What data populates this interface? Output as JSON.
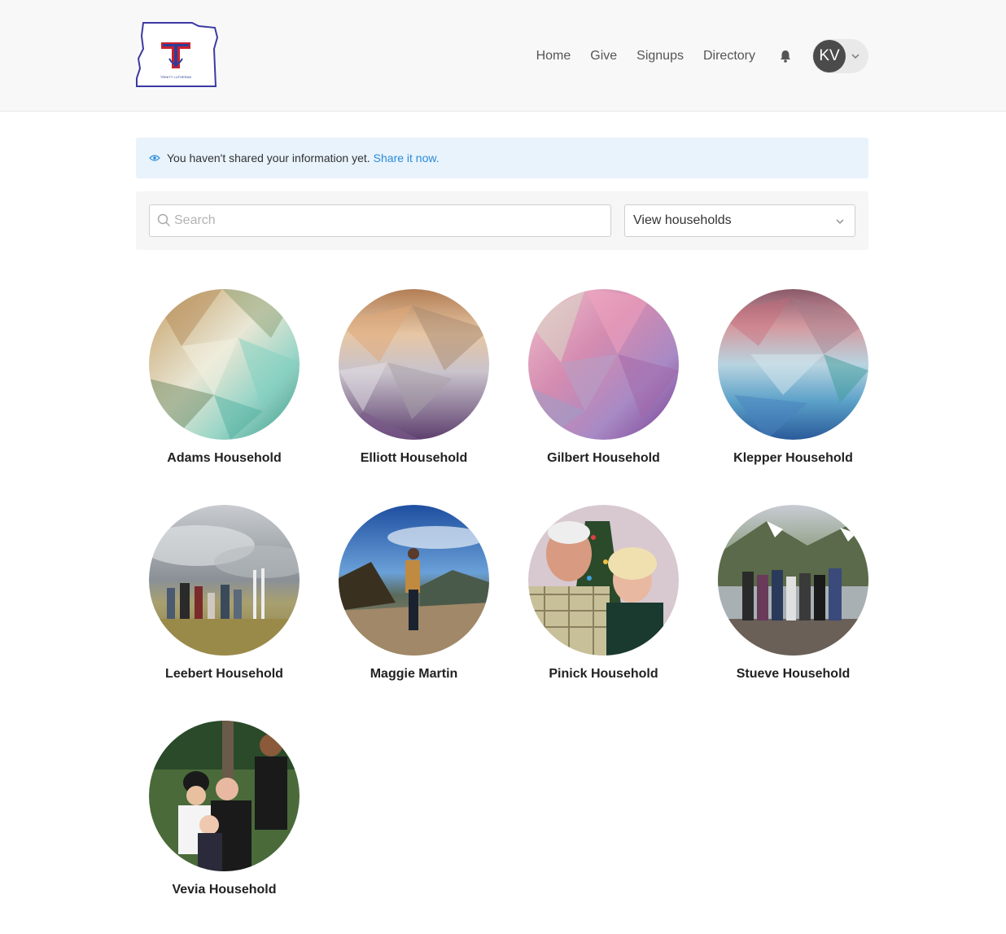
{
  "header": {
    "logo_text": "TRINITY LUTHERAN",
    "nav": [
      "Home",
      "Give",
      "Signups",
      "Directory"
    ],
    "user_initials": "KV"
  },
  "notice": {
    "text": "You haven't shared your information yet.",
    "link": "Share it now."
  },
  "filters": {
    "search_placeholder": "Search",
    "view_select": "View households"
  },
  "households": [
    {
      "name": "Adams Household"
    },
    {
      "name": "Elliott Household"
    },
    {
      "name": "Gilbert Household"
    },
    {
      "name": "Klepper Household"
    },
    {
      "name": "Leebert Household"
    },
    {
      "name": "Maggie Martin"
    },
    {
      "name": "Pinick Household"
    },
    {
      "name": "Stueve Household"
    },
    {
      "name": "Vevia Household"
    }
  ],
  "colors": {
    "notice_bg": "#e8f3fc",
    "link": "#2a8bd8",
    "avatar_bg": "#4b4b4b"
  }
}
